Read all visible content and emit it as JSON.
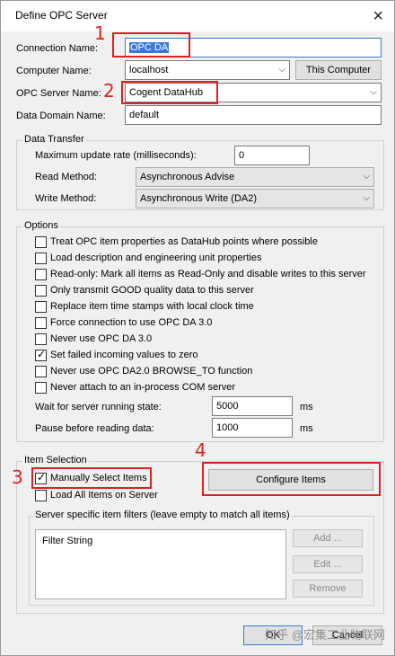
{
  "window": {
    "title": "Define OPC Server",
    "close_icon": "×"
  },
  "connection": {
    "connection_name_label": "Connection Name:",
    "connection_name_value": "OPC DA",
    "computer_name_label": "Computer Name:",
    "computer_name_value": "localhost",
    "this_computer_button": "This Computer",
    "opc_server_label": "OPC Server Name:",
    "opc_server_value": "Cogent DataHub",
    "data_domain_label": "Data Domain Name:",
    "data_domain_value": "default"
  },
  "data_transfer": {
    "title": "Data Transfer",
    "max_update_label": "Maximum update rate (milliseconds):",
    "max_update_value": "0",
    "read_method_label": "Read Method:",
    "read_method_value": "Asynchronous Advise",
    "write_method_label": "Write Method:",
    "write_method_value": "Asynchronous Write (DA2)"
  },
  "options": {
    "title": "Options",
    "items": [
      {
        "label": "Treat OPC item properties as DataHub points where possible",
        "checked": false
      },
      {
        "label": "Load description and engineering unit properties",
        "checked": false
      },
      {
        "label": "Read-only: Mark all items as Read-Only and disable writes to this server",
        "checked": false
      },
      {
        "label": "Only transmit GOOD quality data to this server",
        "checked": false
      },
      {
        "label": "Replace item time stamps with local clock time",
        "checked": false
      },
      {
        "label": "Force connection to use OPC DA 3.0",
        "checked": false
      },
      {
        "label": "Never use OPC DA 3.0",
        "checked": false
      },
      {
        "label": "Set failed incoming values to zero",
        "checked": true
      },
      {
        "label": "Never use OPC DA2.0 BROWSE_TO function",
        "checked": false
      },
      {
        "label": "Never attach to an in-process COM server",
        "checked": false
      }
    ],
    "wait_label": "Wait for server running state:",
    "wait_value": "5000",
    "wait_unit": "ms",
    "pause_label": "Pause before reading data:",
    "pause_value": "1000",
    "pause_unit": "ms"
  },
  "item_selection": {
    "title": "Item Selection",
    "manual_label": "Manually Select Items",
    "manual_checked": true,
    "load_all_label": "Load All Items on Server",
    "load_all_checked": false,
    "configure_button": "Configure Items",
    "filters_title": "Server specific item filters (leave empty to match all items)",
    "filter_header": "Filter String",
    "add_button": "Add ...",
    "edit_button": "Edit ...",
    "remove_button": "Remove"
  },
  "footer": {
    "ok_button": "OK",
    "cancel_button": "Cancel"
  },
  "annotations": [
    "1",
    "2",
    "3",
    "4"
  ],
  "watermark": "知乎 @宏集工业物联网",
  "tick_glyph": "✓",
  "chevron_glyph": "⌵",
  "colors": {
    "highlight": "#e02020",
    "selection": "#3b78d8"
  }
}
